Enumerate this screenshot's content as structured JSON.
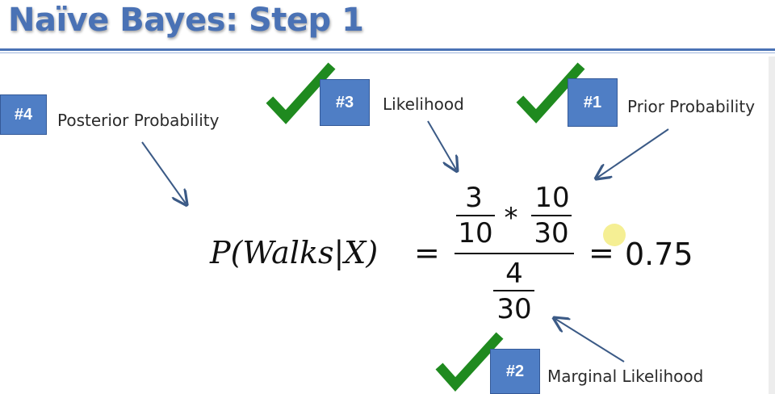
{
  "slide": {
    "title": "Naïve Bayes: Step 1",
    "accent_color": "#4a72b5",
    "check_color": "#1f8a1f"
  },
  "steps": [
    {
      "badge": "#4",
      "label": "Posterior Probability",
      "checked": false
    },
    {
      "badge": "#3",
      "label": "Likelihood",
      "checked": true
    },
    {
      "badge": "#1",
      "label": "Prior Probability",
      "checked": true
    },
    {
      "badge": "#2",
      "label": "Marginal Likelihood",
      "checked": true
    }
  ],
  "equation": {
    "lhs": "P(Walks|X)",
    "equals": "=",
    "num_frac1": {
      "numerator": "3",
      "denominator": "10"
    },
    "times": "*",
    "num_frac2": {
      "numerator": "10",
      "denominator": "30"
    },
    "den_frac": {
      "numerator": "4",
      "denominator": "30"
    },
    "result_equals": "=",
    "result": "0.75"
  },
  "icons": [
    "check-icon",
    "arrow-icon",
    "cursor-highlight-icon"
  ]
}
